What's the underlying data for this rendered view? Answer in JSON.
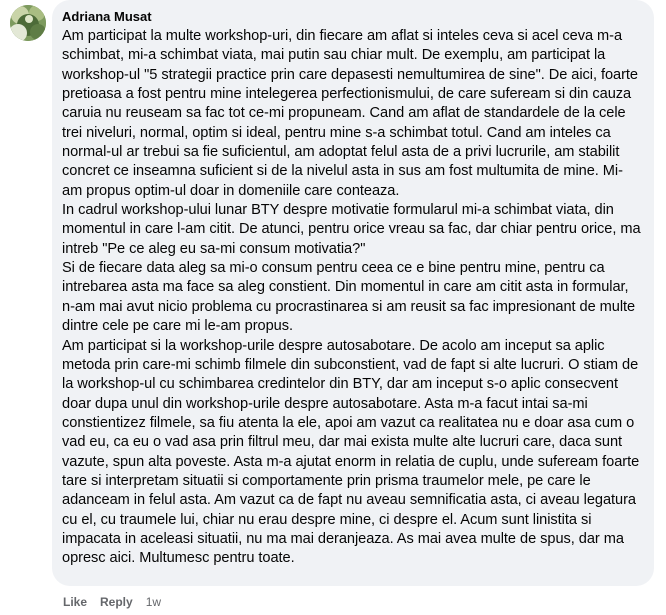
{
  "comment": {
    "author": "Adriana Musat",
    "avatar_icon": "profile-photo-icon",
    "paragraphs": [
      "Am participat la multe workshop-uri, din fiecare am aflat si inteles ceva si acel ceva m-a schimbat, mi-a schimbat viata, mai putin sau chiar mult. De exemplu, am participat la workshop-ul \"5 strategii practice prin care depasesti nemultumirea de sine\". De aici, foarte pretioasa a fost pentru mine intelegerea perfectionismului, de care sufeream si din cauza caruia nu reuseam sa fac tot ce-mi propuneam. Cand am aflat de standardele de la cele trei niveluri, normal, optim si ideal, pentru mine s-a schimbat totul. Cand am inteles ca normal-ul ar trebui sa fie suficientul, am adoptat felul asta de a privi lucrurile, am stabilit concret ce inseamna suficient si de la nivelul asta in sus am fost multumita de mine. Mi-am propus optim-ul doar in domeniile care conteaza.",
      "In cadrul workshop-ului lunar BTY despre motivatie formularul mi-a schimbat viata, din momentul in care l-am citit. De atunci, pentru orice vreau sa fac, dar chiar pentru orice, ma intreb \"Pe ce aleg eu sa-mi consum motivatia?\"",
      "Si de fiecare data aleg sa mi-o consum pentru ceea ce e bine pentru mine, pentru ca intrebarea asta ma face sa aleg constient. Din momentul in care am citit asta in formular, n-am mai avut nicio problema cu procrastinarea si am reusit sa fac impresionant de multe dintre cele pe care mi le-am propus.",
      "Am participat si la workshop-urile despre autosabotare. De acolo am inceput sa aplic metoda prin care-mi schimb filmele din subconstient, vad de fapt si alte lucruri. O stiam de la workshop-ul cu schimbarea credintelor din BTY, dar am inceput s-o aplic consecvent doar dupa unul din workshop-urile despre autosabotare. Asta m-a facut intai sa-mi constientizez filmele, sa fiu atenta la ele, apoi am vazut ca realitatea nu e doar asa cum o vad eu, ca eu o vad asa prin filtrul meu, dar mai exista multe alte lucruri care, daca sunt vazute, spun alta poveste. Asta m-a ajutat enorm in relatia de cuplu, unde sufeream foarte tare si interpretam situatii si comportamente prin prisma traumelor mele, pe care le adanceam in felul asta. Am vazut ca de fapt nu aveau semnificatia asta, ci aveau legatura cu el, cu traumele lui, chiar nu erau despre mine, ci despre el. Acum sunt linistita si impacata in aceleasi situatii, nu ma mai deranjeaza. As mai avea multe de spus, dar ma opresc aici. Multumesc pentru toate."
    ]
  },
  "actions": {
    "like_label": "Like",
    "reply_label": "Reply",
    "timestamp": "1w"
  }
}
